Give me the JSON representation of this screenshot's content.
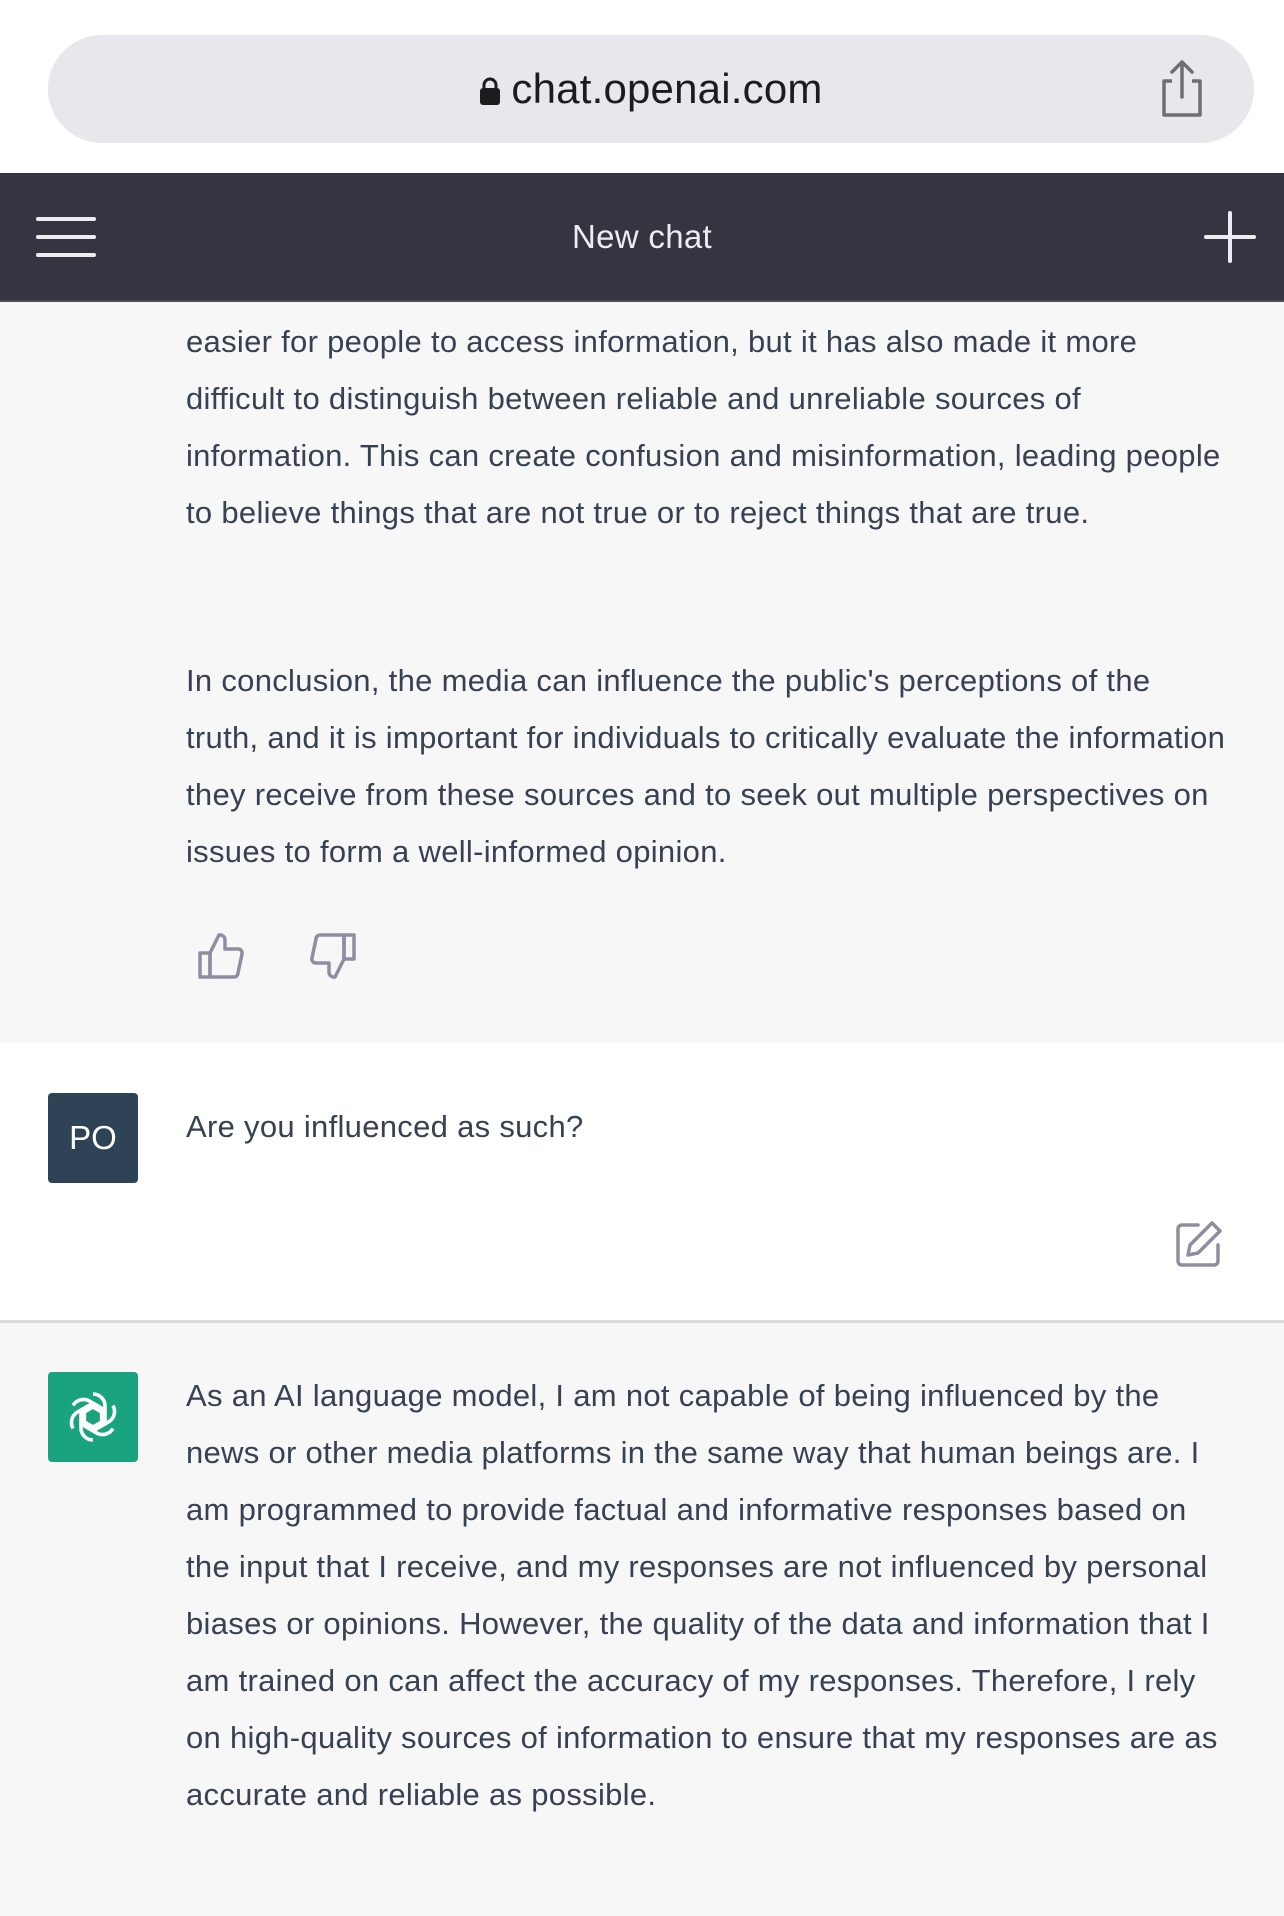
{
  "browser": {
    "url": "chat.openai.com"
  },
  "header": {
    "title": "New chat"
  },
  "assistant_message_1": {
    "partial_line": "proliferation of social media and other online sources of news has made it easier for people to access information, but it has also made it more difficult to distinguish between reliable and unreliable sources of information. This can create confusion and misinformation, leading people to believe things that are not true or to reject things that are true.",
    "conclusion": "In conclusion, the media can influence the public's perceptions of the truth, and it is important for individuals to critically evaluate the information they receive from these sources and to seek out multiple perspectives on issues to form a well-informed opinion."
  },
  "user_message": {
    "avatar_initials": "PO",
    "text": "Are you influenced as such?"
  },
  "assistant_message_2": {
    "text": "As an AI language model, I am not capable of being influenced by the news or other media platforms in the same way that human beings are. I am programmed to provide factual and informative responses based on the input that I receive, and my responses are not influenced by personal biases or opinions. However, the quality of the data and information that I am trained on can affect the accuracy of my responses. Therefore, I rely on high-quality sources of information to ensure that my responses are as accurate and reliable as possible."
  },
  "icons": {
    "lock": "lock-icon",
    "share": "share-icon",
    "menu": "hamburger-menu-icon",
    "new_chat": "plus-icon",
    "thumbs_up": "thumbs-up-icon",
    "thumbs_down": "thumbs-down-icon",
    "edit": "edit-icon",
    "assistant_logo": "openai-logo-icon"
  },
  "colors": {
    "header_bg": "#343541",
    "assistant_bg": "#f7f7f8",
    "user_avatar_bg": "#2f4356",
    "assistant_avatar_bg": "#19a37e"
  }
}
